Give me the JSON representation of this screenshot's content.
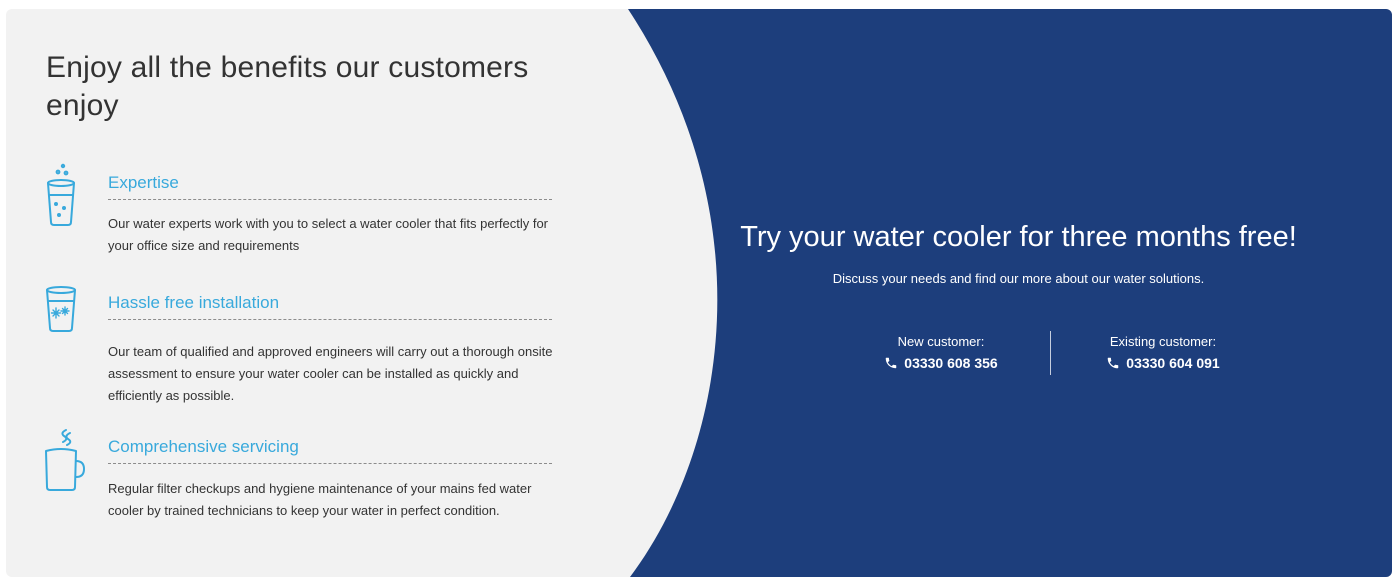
{
  "benefits": {
    "heading": "Enjoy all the benefits our customers enjoy",
    "features": [
      {
        "title": "Expertise",
        "description": "Our water experts work with you to select a water cooler that fits perfectly for your office size and requirements",
        "icon": "water-glass-bubbles-icon"
      },
      {
        "title": "Hassle free installation",
        "description": "Our team of qualified and approved engineers will carry out a thorough onsite assessment to ensure your water cooler can be installed as quickly and efficiently as possible.",
        "icon": "water-glass-ice-icon"
      },
      {
        "title": "Comprehensive servicing",
        "description": "Regular filter checkups and hygiene maintenance of your mains fed water cooler by trained technicians to keep your water in perfect condition.",
        "icon": "hot-mug-icon"
      }
    ]
  },
  "cta": {
    "title": "Try your water cooler for three months free!",
    "subtitle": "Discuss your needs and find our more about our water solutions.",
    "new_customer": {
      "label": "New customer:",
      "phone": "03330 608 356",
      "icon": "phone-icon"
    },
    "existing_customer": {
      "label": "Existing customer:",
      "phone": "03330 604 091",
      "icon": "phone-icon"
    }
  },
  "colors": {
    "blue_panel": "#1d3e7c",
    "light_panel": "#f2f2f2",
    "accent": "#38a9dc",
    "heading_text": "#333333"
  }
}
